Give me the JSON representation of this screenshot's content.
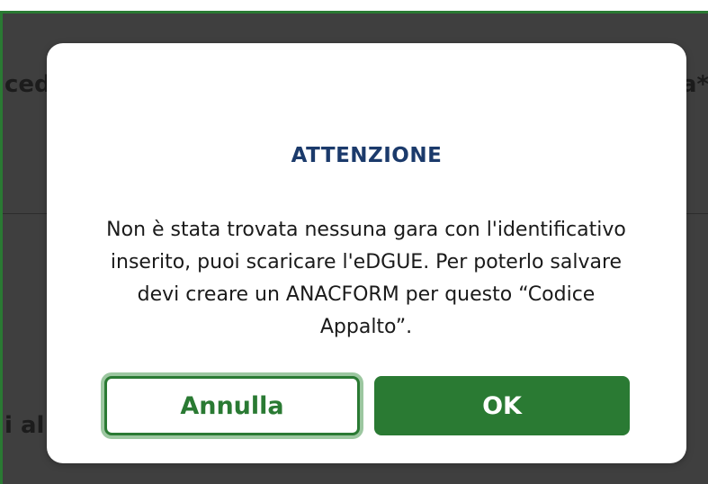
{
  "background": {
    "fragment_left_top": "ced",
    "fragment_right_top": "a*",
    "fragment_left_bottom": "i al"
  },
  "dialog": {
    "title": "ATTENZIONE",
    "message": "Non è stata trovata nessuna gara con l'identificativo inserito, puoi scaricare l'eDGUE. Per poterlo salvare devi creare un ANACFORM per questo “Codice Appalto”.",
    "cancel_label": "Annulla",
    "ok_label": "OK"
  },
  "colors": {
    "accent_green": "#2a7a33",
    "title_navy": "#1b3a6b",
    "overlay": "#3f3f3f"
  }
}
